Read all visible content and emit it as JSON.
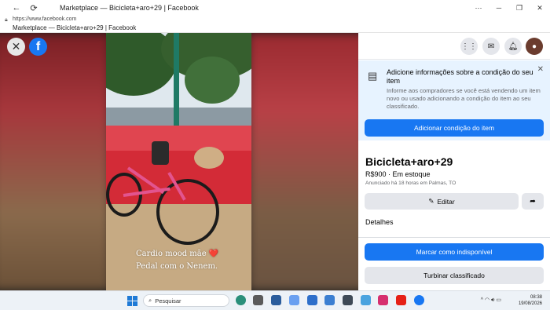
{
  "browser": {
    "tab_title": "Marketplace — Bicicleta+aro+29 | Facebook",
    "url": "https://www.facebook.com",
    "page_title": "Marketplace — Bicicleta+aro+29 | Facebook"
  },
  "media": {
    "caption_line1": "Cardio mood mãe ❤️",
    "caption_line2": "Pedal com o Nenem."
  },
  "notice": {
    "title": "Adicione informações sobre a condição do seu item",
    "text": "Informe aos compradores se você está vendendo um item novo ou usado adicionando a condição do item ao seu classificado.",
    "button": "Adicionar condição do item"
  },
  "listing": {
    "title": "Bicicleta+aro+29",
    "price": "R$900 · Em estoque",
    "meta": "Anunciado há 18 horas em Palmas, TO",
    "edit_label": "Editar",
    "details_label": "Detalhes"
  },
  "actions": {
    "mark_unavailable": "Marcar como indisponível",
    "boost": "Turbinar classificado"
  },
  "taskbar": {
    "search_placeholder": "Pesquisar",
    "time": "08:38",
    "date": "19/08/2026"
  },
  "colors": {
    "facebook_blue": "#1877f2",
    "notice_bg": "#e7f3ff"
  }
}
